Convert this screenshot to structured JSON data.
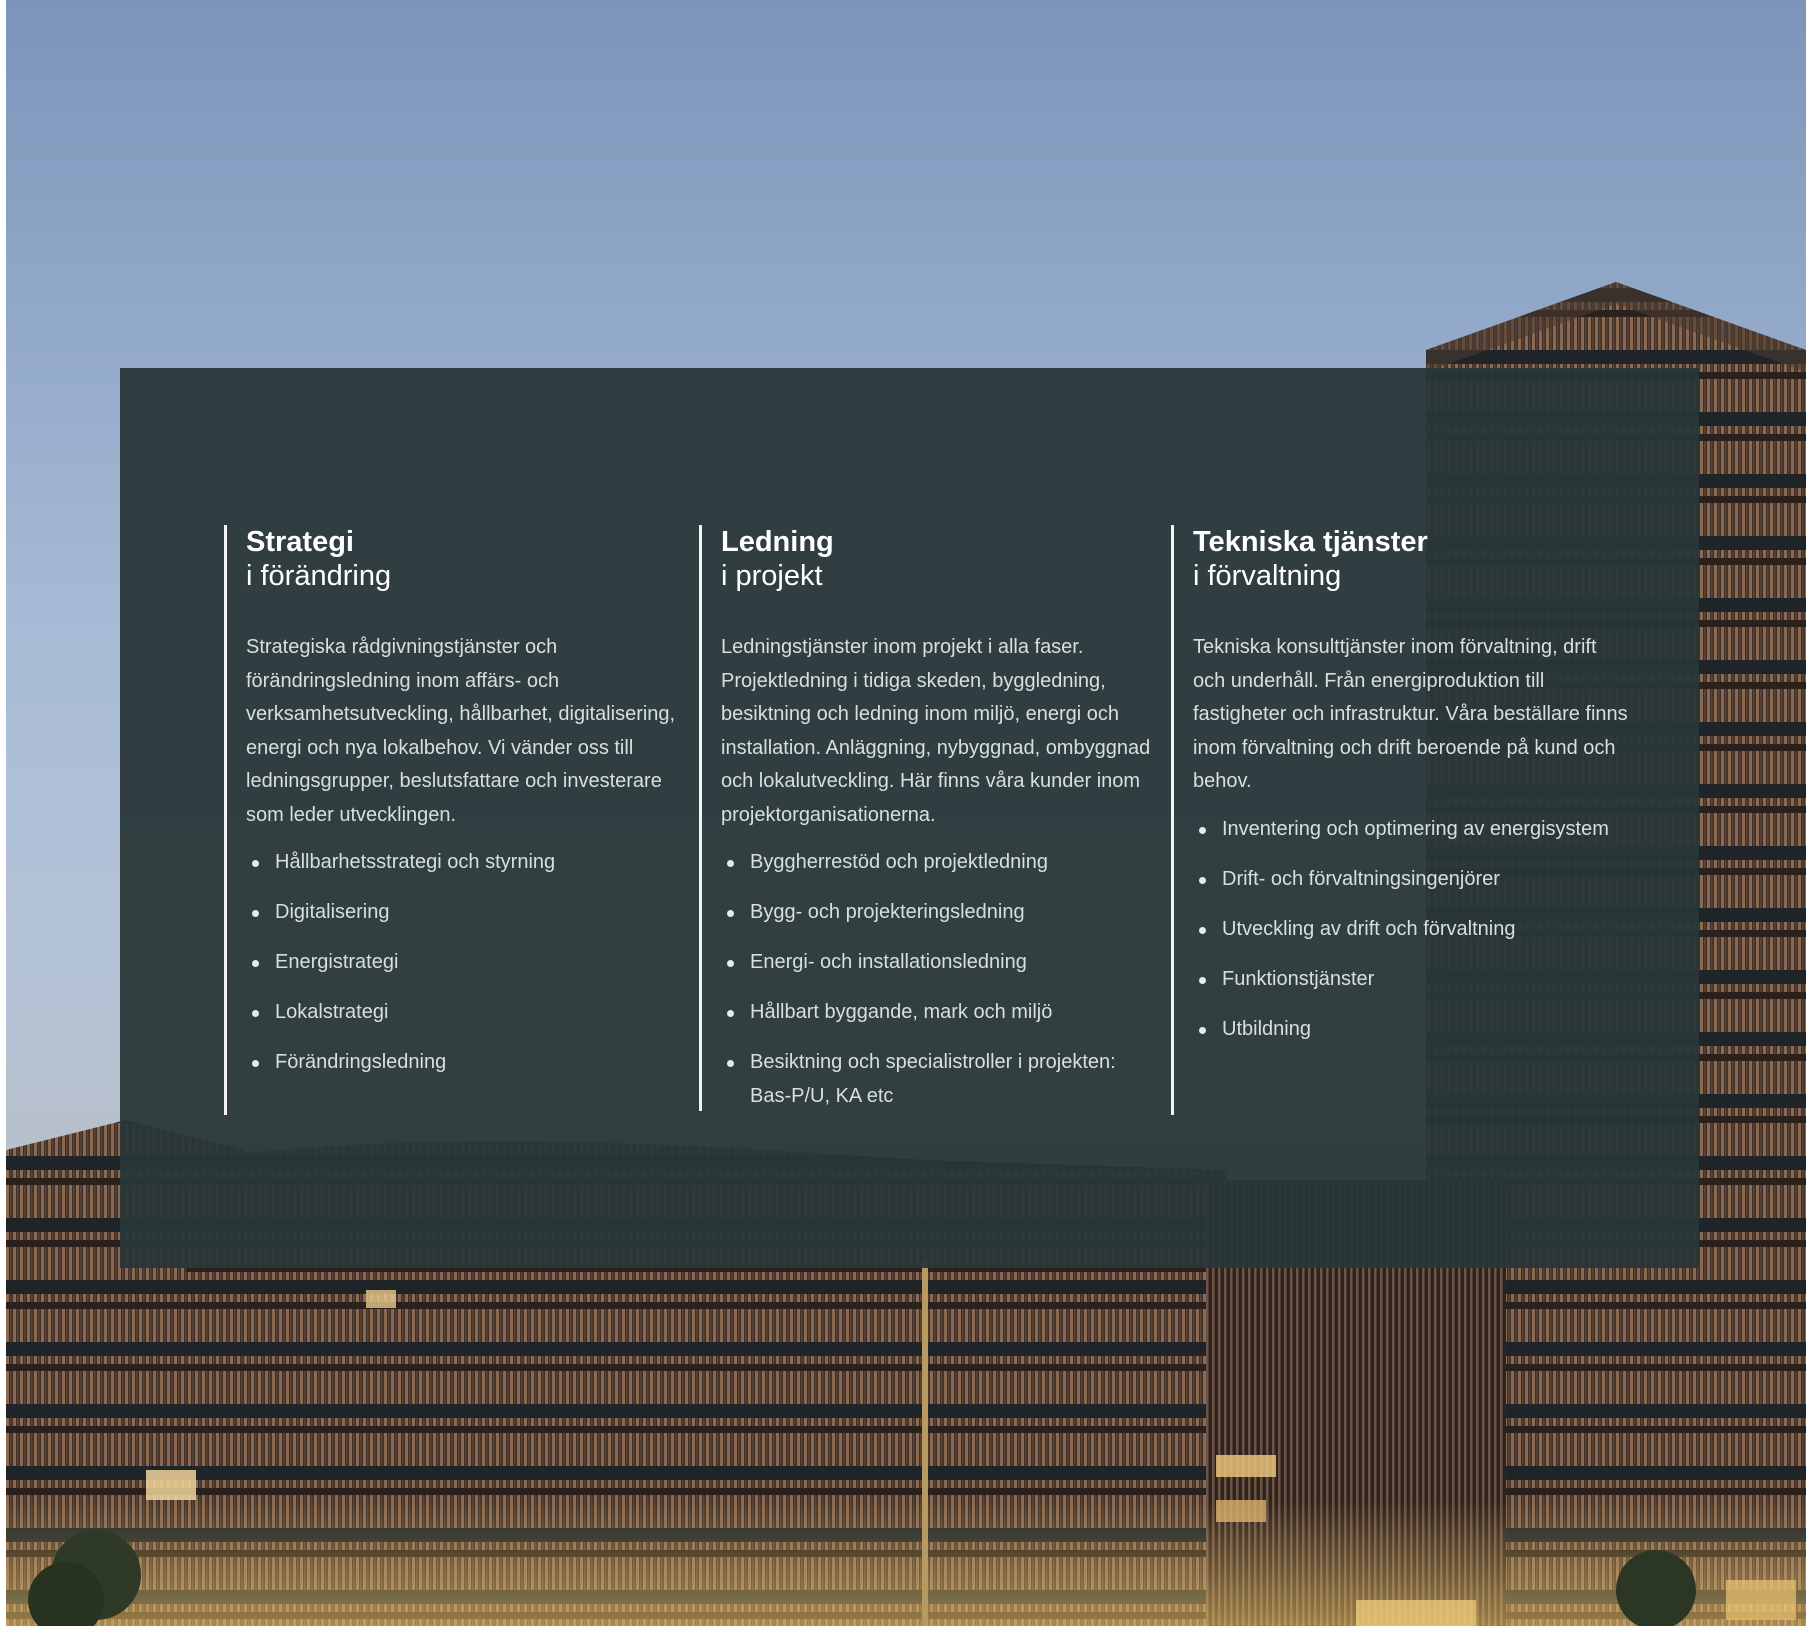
{
  "columns": [
    {
      "title": "Strategi",
      "subtitle": "i förändring",
      "intro": "Strategiska rådgivningstjänster och förändringsledning inom affärs- och verksamhetsutveckling, hållbarhet, digitalisering, energi och nya lokalbehov. Vi vänder oss till ledningsgrupper, beslutsfattare och investerare som leder utvecklingen.",
      "items": [
        "Hållbarhetsstrategi och styrning",
        "Digitalisering",
        "Energistrategi",
        "Lokalstrategi",
        "Förändringsledning"
      ]
    },
    {
      "title": "Ledning",
      "subtitle": "i projekt",
      "intro": "Ledningstjänster inom projekt i alla faser. Projektledning i tidiga skeden, byggledning, besiktning och ledning inom miljö, energi och installation. Anläggning, nybyggnad, ombyggnad och lokalutveckling. Här finns våra kunder inom projektorganisationerna.",
      "items": [
        "Byggherrestöd och projektledning",
        "Bygg- och projekteringsledning",
        "Energi- och installationsledning",
        "Hållbart byggande, mark och miljö",
        "Besiktning och specialistroller i projekten: Bas-P/U, KA etc"
      ]
    },
    {
      "title": "Tekniska tjänster",
      "subtitle": "i förvaltning",
      "intro": "Tekniska konsulttjänster inom förvaltning, drift och underhåll. Från energiproduktion till fastigheter och infrastruktur. Våra beställare finns inom förvaltning och drift beroende på kund och behov.",
      "items": [
        "Inventering och optimering av energisystem",
        "Drift- och förvaltningsingenjörer",
        "Utveckling av drift och förvaltning",
        "Funktionstjänster",
        "Utbildning"
      ]
    }
  ],
  "colors": {
    "panel": "#283637",
    "sky_top": "#7d94ba",
    "facade": "#5a4436",
    "divider": "#f2f4f3"
  }
}
